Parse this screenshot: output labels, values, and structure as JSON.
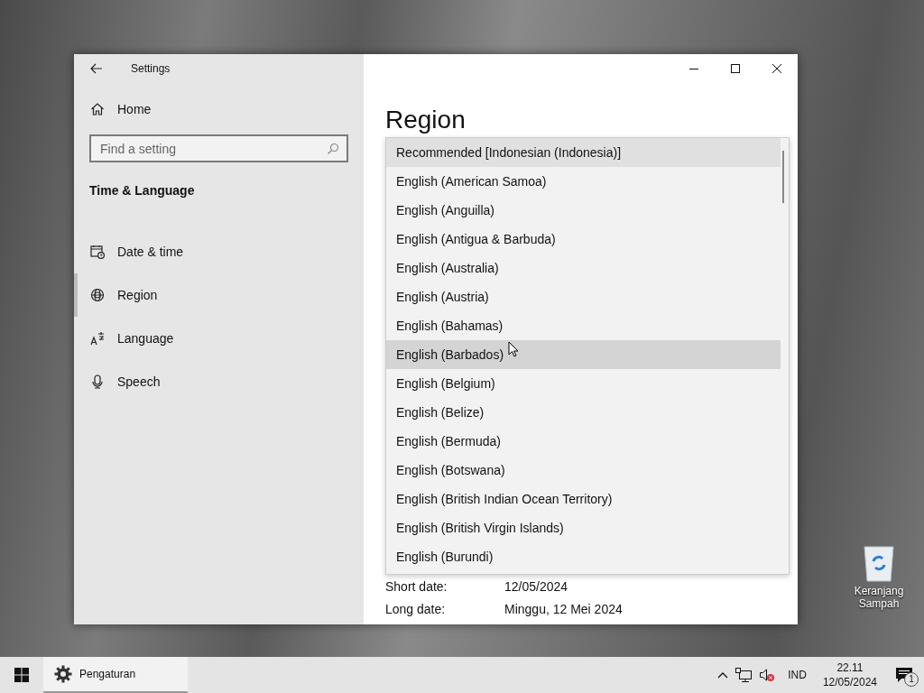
{
  "window": {
    "title": "Settings"
  },
  "sidebar": {
    "home": "Home",
    "search": {
      "placeholder": "Find a setting"
    },
    "section": "Time & Language",
    "items": [
      {
        "label": "Date & time",
        "selected": false
      },
      {
        "label": "Region",
        "selected": true
      },
      {
        "label": "Language",
        "selected": false
      },
      {
        "label": "Speech",
        "selected": false
      }
    ]
  },
  "content": {
    "title": "Region",
    "dropdown_options": [
      {
        "label": "Recommended [Indonesian (Indonesia)]",
        "selected": true,
        "hovered": false
      },
      {
        "label": "English (American Samoa)",
        "selected": false,
        "hovered": false
      },
      {
        "label": "English (Anguilla)",
        "selected": false,
        "hovered": false
      },
      {
        "label": "English (Antigua & Barbuda)",
        "selected": false,
        "hovered": false
      },
      {
        "label": "English (Australia)",
        "selected": false,
        "hovered": false
      },
      {
        "label": "English (Austria)",
        "selected": false,
        "hovered": false
      },
      {
        "label": "English (Bahamas)",
        "selected": false,
        "hovered": false
      },
      {
        "label": "English (Barbados)",
        "selected": false,
        "hovered": true
      },
      {
        "label": "English (Belgium)",
        "selected": false,
        "hovered": false
      },
      {
        "label": "English (Belize)",
        "selected": false,
        "hovered": false
      },
      {
        "label": "English (Bermuda)",
        "selected": false,
        "hovered": false
      },
      {
        "label": "English (Botswana)",
        "selected": false,
        "hovered": false
      },
      {
        "label": "English (British Indian Ocean Territory)",
        "selected": false,
        "hovered": false
      },
      {
        "label": "English (British Virgin Islands)",
        "selected": false,
        "hovered": false
      },
      {
        "label": "English (Burundi)",
        "selected": false,
        "hovered": false
      }
    ],
    "formats": [
      {
        "label": "Short date:",
        "value": "12/05/2024"
      },
      {
        "label": "Long date:",
        "value": "Minggu, 12 Mei 2024"
      }
    ]
  },
  "desktop": {
    "icons": [
      {
        "label": "Keranjang Sampah"
      }
    ]
  },
  "taskbar": {
    "apps": [
      {
        "label": "Pengaturan",
        "selected": true
      }
    ],
    "language": "IND",
    "time": "22.11",
    "date": "12/05/2024",
    "notifications": "1"
  }
}
